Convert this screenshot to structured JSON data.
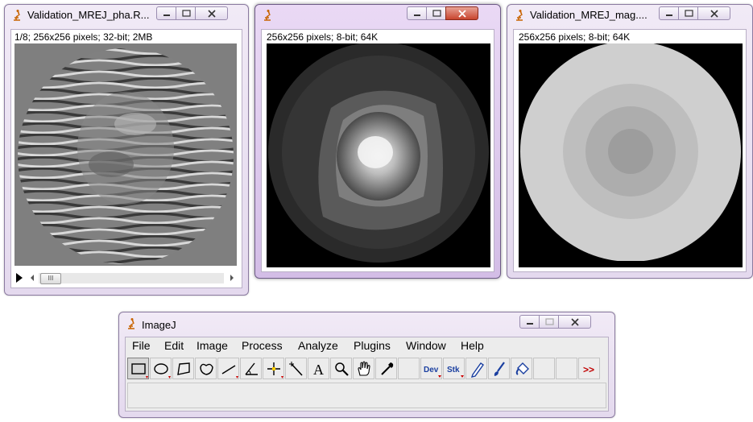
{
  "windows": {
    "phase": {
      "title": "Validation_MREJ_pha.R...",
      "info": "1/8; 256x256 pixels; 32-bit; 2MB",
      "scroll_thumb": "III"
    },
    "mid": {
      "title": "",
      "info": "256x256 pixels; 8-bit; 64K"
    },
    "mag": {
      "title": "Validation_MREJ_mag....",
      "info": "256x256 pixels; 8-bit; 64K"
    }
  },
  "imagej": {
    "title": "ImageJ",
    "menu": [
      "File",
      "Edit",
      "Image",
      "Process",
      "Analyze",
      "Plugins",
      "Window",
      "Help"
    ],
    "tools": [
      {
        "name": "rectangle-tool-icon",
        "selected": true
      },
      {
        "name": "oval-tool-icon"
      },
      {
        "name": "polygon-tool-icon"
      },
      {
        "name": "freehand-tool-icon"
      },
      {
        "name": "line-tool-icon"
      },
      {
        "name": "angle-tool-icon"
      },
      {
        "name": "point-tool-icon"
      },
      {
        "name": "wand-tool-icon"
      },
      {
        "name": "text-tool-icon",
        "label": "A"
      },
      {
        "name": "magnifier-tool-icon"
      },
      {
        "name": "hand-tool-icon"
      },
      {
        "name": "dropper-tool-icon"
      },
      {
        "name": "blank-slot-icon"
      },
      {
        "name": "dev-tool-icon",
        "label": "Dev"
      },
      {
        "name": "stk-tool-icon",
        "label": "Stk"
      },
      {
        "name": "pencil-tool-icon"
      },
      {
        "name": "brush-tool-icon"
      },
      {
        "name": "flood-fill-tool-icon"
      },
      {
        "name": "blank-slot-icon"
      },
      {
        "name": "blank-slot-icon"
      },
      {
        "name": "more-tools-icon",
        "label": ">>"
      }
    ]
  },
  "colors": {
    "title_bar": "#e4d9ee",
    "active_title_bar": "#d3bde6",
    "close_red": "#c8452e",
    "phase_bg": "#7f7f7f",
    "mag_outer": "#cfcfcf",
    "mag_ring": "#bebebe",
    "mag_inner": "#adadad",
    "mag_core": "#9d9d9d"
  }
}
